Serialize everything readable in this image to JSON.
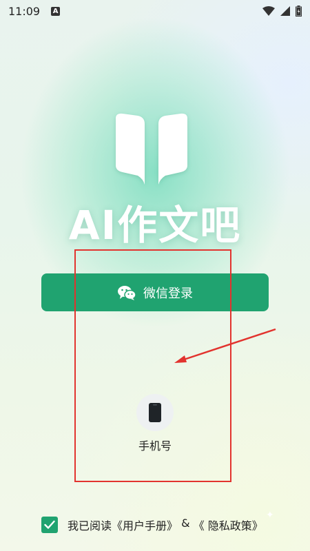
{
  "status_bar": {
    "time": "11:09",
    "notif_glyph": "A"
  },
  "app": {
    "name": "AI作文吧"
  },
  "wechat_login": {
    "label": "微信登录",
    "icon": "wechat-icon",
    "color": "#20a370"
  },
  "phone_login": {
    "label": "手机号",
    "icon": "phone-icon"
  },
  "agreement": {
    "checked": true,
    "prefix": "我已阅读",
    "user_manual": "《用户手册》",
    "and": " & ",
    "privacy_policy": "《 隐私政策》"
  },
  "annotation_color": "#e2332e"
}
